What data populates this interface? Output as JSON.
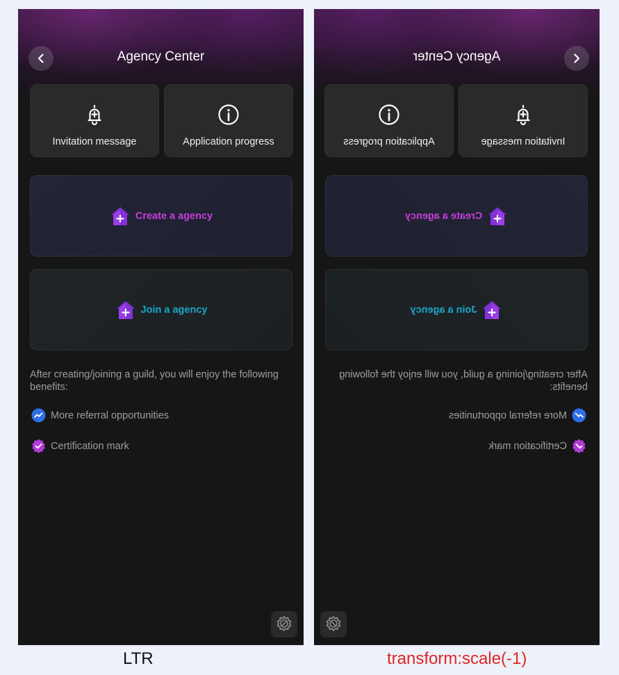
{
  "screen": {
    "title": "Agency Center",
    "tiles": [
      {
        "label": "Invitation message",
        "icon": "bell-plus-icon"
      },
      {
        "label": "Application progress",
        "icon": "info-circle-icon"
      }
    ],
    "create_card": {
      "label": "Create a agency",
      "icon": "purple-house-plus-icon",
      "color": "#c63ddc"
    },
    "join_card": {
      "label": "Join a agency",
      "icon": "purple-house-plus-icon",
      "color": "#1ba6c8"
    },
    "benefits_intro": "After creating/joining a guild, you will enjoy the following benefits:",
    "benefits": [
      {
        "label": "More referral opportunities",
        "icon": "blue-trend-icon"
      },
      {
        "label": "Certification mark",
        "icon": "purple-verified-badge-icon"
      }
    ]
  },
  "captions": {
    "ltr": "LTR",
    "rtl": "transform:scale(-1)"
  },
  "colors": {
    "background": "#161616",
    "tile": "#2c2c2c",
    "accent_create": "#c63ddc",
    "accent_join": "#1ba6c8",
    "caption_rtl": "#e02626"
  }
}
